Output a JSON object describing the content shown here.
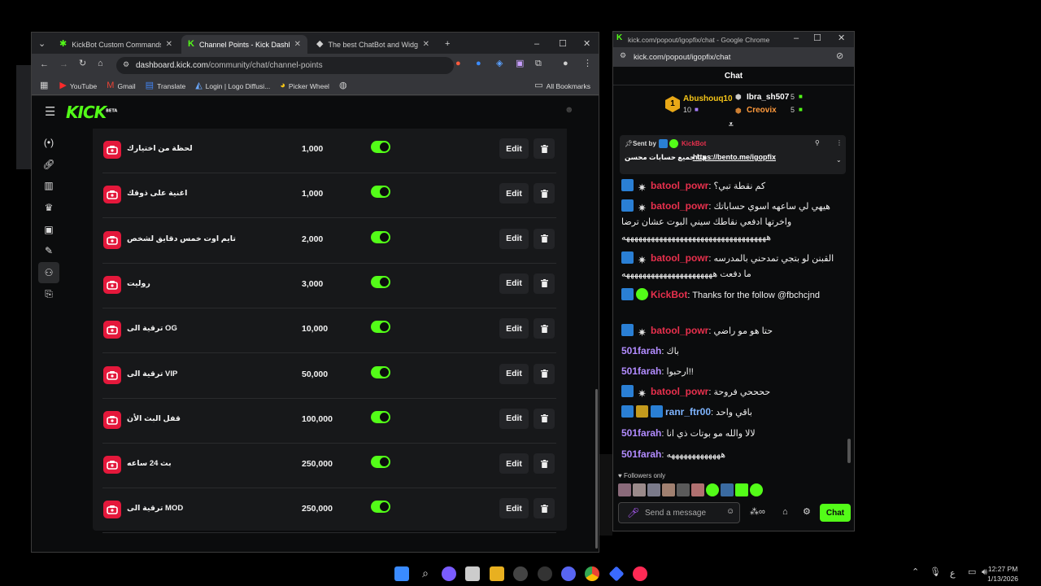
{
  "browser": {
    "tabs": [
      {
        "title": "KickBot Custom Commands",
        "active": false
      },
      {
        "title": "Channel Points - Kick Dashboard",
        "active": true
      },
      {
        "title": "The best ChatBot and Widgets",
        "active": false
      }
    ],
    "url_host": "dashboard.kick.com",
    "url_path": "/community/chat/channel-points",
    "bookmarks": [
      "YouTube",
      "Gmail",
      "Translate",
      "Login | Logo Diffusi...",
      "Picker Wheel"
    ],
    "all_bookmarks": "All Bookmarks"
  },
  "kick": {
    "logo": "KICK",
    "logo_sup": "BETA",
    "edit_label": "Edit",
    "rewards": [
      {
        "name": "لحظة من اختيارك",
        "cost": "1,000",
        "enabled": true
      },
      {
        "name": "اغنية على ذوقك",
        "cost": "1,000",
        "enabled": true
      },
      {
        "name": "تايم اوت خمس دقايق لشخص",
        "cost": "2,000",
        "enabled": true
      },
      {
        "name": "روليت",
        "cost": "3,000",
        "enabled": true
      },
      {
        "name": "ترقية الى OG",
        "cost": "10,000",
        "enabled": true
      },
      {
        "name": "ترقية الى VIP",
        "cost": "50,000",
        "enabled": true
      },
      {
        "name": "قفل البث الأن",
        "cost": "100,000",
        "enabled": true
      },
      {
        "name": "بث 24 ساعه",
        "cost": "250,000",
        "enabled": true
      },
      {
        "name": "ترقية الى MOD",
        "cost": "250,000",
        "enabled": true
      }
    ]
  },
  "chat": {
    "window_title": "kick.com/popout/igopfix/chat - Google Chrome",
    "url": "kick.com/popout/igopfix/chat",
    "header": "Chat",
    "leaderboard": [
      {
        "rank": "1",
        "name": "Abushouq10",
        "count": "10"
      },
      {
        "name": "Ibra_sh507",
        "count": "5"
      },
      {
        "name": "Creovix",
        "count": "5"
      }
    ],
    "pinned": {
      "sent_by": "Sent by",
      "bot": "KickBot",
      "text": "هنا جميع حسابات محسن :",
      "link": "https://bento.me/igopfix"
    },
    "messages": [
      {
        "user": "batool_powr",
        "color": "#e8304d",
        "text": "كم نقطة تبي؟",
        "badges": [
          "blue",
          "star"
        ]
      },
      {
        "user": "batool_powr",
        "color": "#e8304d",
        "text": "هيهي لي ساعهه اسوي حساباتك واخرتها ادفعي نقاطك سيني البوت عشان ترضا هههههههههههههههههههههههههههههههههههه",
        "badges": [
          "blue",
          "star"
        ]
      },
      {
        "user": "batool_powr",
        "color": "#e8304d",
        "text": "القبنن لو بتجي تمدحني بالمدرسه ما دفعت ههههههههههههههههههههههه",
        "badges": [
          "blue",
          "star"
        ]
      },
      {
        "user": "KickBot",
        "color": "#e8304d",
        "text": "Thanks for the follow @fbchcjnd",
        "badges": [
          "blue",
          "green"
        ]
      },
      {
        "user": "batool_powr",
        "color": "#e8304d",
        "text": "حتا هو مو راضي",
        "badges": [
          "blue",
          "star"
        ]
      },
      {
        "user": "501farah",
        "color": "#b28cff",
        "text": "باك",
        "badges": []
      },
      {
        "user": "501farah",
        "color": "#b28cff",
        "text": "ارحبوا!!",
        "badges": []
      },
      {
        "user": "batool_powr",
        "color": "#e8304d",
        "text": "ححححي فروحة",
        "badges": [
          "blue",
          "star"
        ]
      },
      {
        "user": "ranr_ftr00",
        "color": "#7fb5ff",
        "text": "باقي واحد",
        "badges": [
          "blue",
          "gold",
          "blue"
        ]
      },
      {
        "user": "501farah",
        "color": "#b28cff",
        "text": "لالا والله مو بوتات ذي انا",
        "badges": []
      },
      {
        "user": "501farah",
        "color": "#b28cff",
        "text": "هههههههههههههه",
        "badges": []
      }
    ],
    "followers_only": "Followers only",
    "input_placeholder": "Send a message",
    "send_label": "Chat"
  },
  "taskbar": {
    "time": "12:27 PM",
    "date": "1/13/2026",
    "lang": "ع"
  }
}
